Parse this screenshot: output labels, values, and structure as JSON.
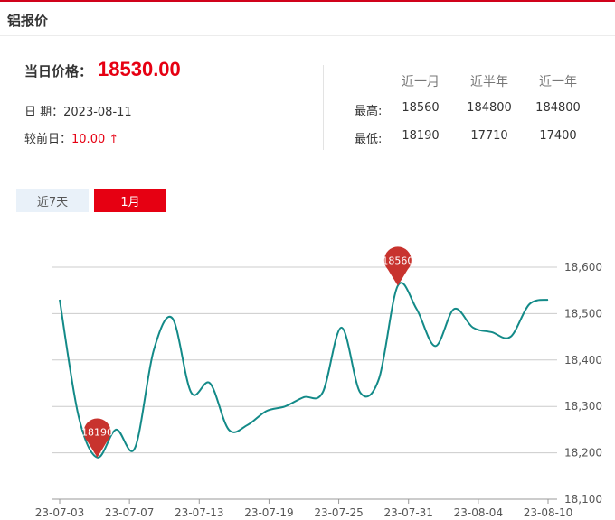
{
  "header": {
    "title": "铝报价"
  },
  "price": {
    "label": "当日价格：",
    "value": "18530.00"
  },
  "date": {
    "label": "日 期：",
    "value": "2023-08-11"
  },
  "change": {
    "label": "较前日：",
    "value": "10.00 ↑"
  },
  "stats": {
    "headers": [
      "近一月",
      "近半年",
      "近一年"
    ],
    "rows": [
      {
        "label": "最高:",
        "values": [
          "18560",
          "184800",
          "184800"
        ]
      },
      {
        "label": "最低:",
        "values": [
          "18190",
          "17710",
          "17400"
        ]
      }
    ]
  },
  "tabs": [
    {
      "label": "近7天",
      "active": false
    },
    {
      "label": "1月",
      "active": true
    }
  ],
  "colors": {
    "line": "#138a88",
    "accent": "#e60012",
    "marker": "#c8332e",
    "grid": "#cccccc"
  },
  "chart_data": {
    "type": "line",
    "x_ticks": [
      "23-07-03",
      "23-07-07",
      "23-07-13",
      "23-07-19",
      "23-07-25",
      "23-07-31",
      "23-08-04",
      "23-08-10"
    ],
    "y_ticks": [
      "18,600",
      "18,500",
      "18,400",
      "18,300",
      "18,200",
      "18,100"
    ],
    "ylim": [
      18100,
      18600
    ],
    "grid": true,
    "series": [
      {
        "values": [
          18530,
          18280,
          18190,
          18250,
          18210,
          18420,
          18490,
          18330,
          18350,
          18250,
          18260,
          18290,
          18300,
          18320,
          18330,
          18470,
          18330,
          18360,
          18560,
          18510,
          18430,
          18510,
          18470,
          18460,
          18450,
          18520,
          18530
        ]
      }
    ],
    "annotations": [
      {
        "label": "18190",
        "index": 2,
        "value": 18190
      },
      {
        "label": "18560",
        "index": 18,
        "value": 18560
      }
    ]
  }
}
